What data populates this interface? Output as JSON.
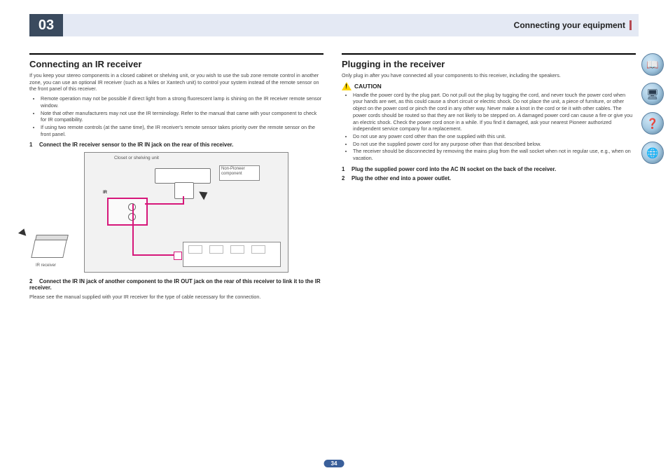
{
  "header": {
    "chapter": "03",
    "title": "Connecting your equipment"
  },
  "left": {
    "heading": "Connecting an IR receiver",
    "intro": "If you keep your stereo components in a closed cabinet or shelving unit, or you wish to use the sub zone remote control in another zone, you can use an optional IR receiver (such as a Niles or Xantech unit) to control your system instead of the remote sensor on the front panel of this receiver.",
    "bullets": [
      "Remote operation may not be possible if direct light from a strong fluorescent lamp is shining on the IR receiver remote sensor window.",
      "Note that other manufacturers may not use the IR terminology. Refer to the manual that came with your component to check for IR compatibility.",
      "If using two remote controls (at the same time), the IR receiver's remote sensor takes priority over the remote sensor on the front panel."
    ],
    "step1": "Connect the IR receiver sensor to the IR IN jack on the rear of this receiver.",
    "diagram": {
      "closet_label": "Closet or shelving unit",
      "callout": "Non-Pioneer component",
      "ir_label": "IR",
      "ir_receiver_label": "IR receiver"
    },
    "step2": "Connect the IR IN jack of another component to the IR OUT jack on the rear of this receiver to link it to the IR receiver.",
    "step2_note": "Please see the manual supplied with your IR receiver for the type of cable necessary for the connection."
  },
  "right": {
    "heading": "Plugging in the receiver",
    "intro": "Only plug in after you have connected all your components to this receiver, including the speakers.",
    "caution_label": "CAUTION",
    "bullets": [
      "Handle the power cord by the plug part. Do not pull out the plug by tugging the cord, and never touch the power cord when your hands are wet, as this could cause a short circuit or electric shock. Do not place the unit, a piece of furniture, or other object on the power cord or pinch the cord in any other way. Never make a knot in the cord or tie it with other cables. The power cords should be routed so that they are not likely to be stepped on. A damaged power cord can cause a fire or give you an electric shock. Check the power cord once in a while. If you find it damaged, ask your nearest Pioneer authorized independent service company for a replacement.",
      "Do not use any power cord other than the one supplied with this unit.",
      "Do not use the supplied power cord for any purpose other than that described below.",
      "The receiver should be disconnected by removing the mains plug from the wall socket when not in regular use, e.g., when on vacation."
    ],
    "step1": "Plug the supplied power cord into the AC IN socket on the back of the receiver.",
    "step2": "Plug the other end into a power outlet."
  },
  "page_number": "34",
  "side_icons": {
    "book": "book-icon",
    "hardware": "hardware-icon",
    "help": "help-icon",
    "network": "network-icon"
  }
}
